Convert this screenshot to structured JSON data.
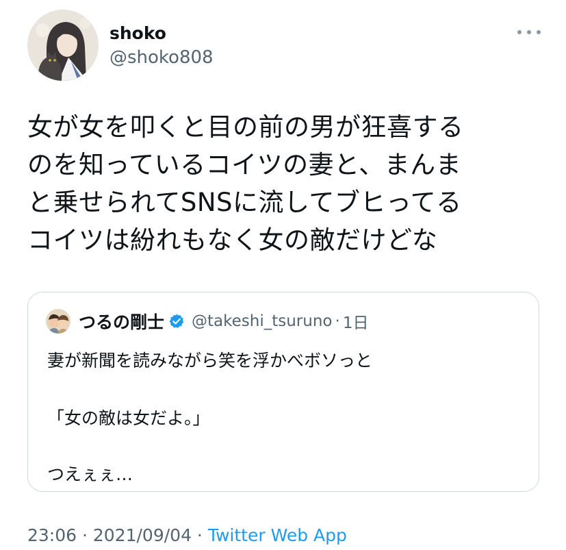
{
  "author": {
    "name": "shoko",
    "handle": "@shoko808",
    "avatar_icon": "avatar-illustration-woman-with-cat"
  },
  "more_icon": "more-horizontal-icon",
  "tweet": {
    "lines": [
      "女が女を叩くと目の前の男が狂喜する",
      "のを知っているコイツの妻と、まんま",
      "と乗せられてSNSに流してブヒってる",
      "コイツは紛れもなく女の敵だけどな"
    ]
  },
  "quoted_tweet": {
    "name": "つるの剛士",
    "verified_icon": "verified-badge-icon",
    "handle": "@takeshi_tsuruno",
    "separator": "·",
    "time": "1日",
    "lines": [
      "妻が新聞を読みながら笑を浮かべボソっと",
      "「女の敵は女だよ。」",
      "つえぇぇ…"
    ]
  },
  "meta": {
    "time": "23:06",
    "separator1": " · ",
    "date": "2021/09/04",
    "separator2": " · ",
    "source": "Twitter Web App"
  },
  "colors": {
    "text": "#0f1419",
    "secondary": "#536471",
    "link": "#1d9bf0",
    "border": "#cfd9de",
    "verified": "#1d9bf0"
  }
}
